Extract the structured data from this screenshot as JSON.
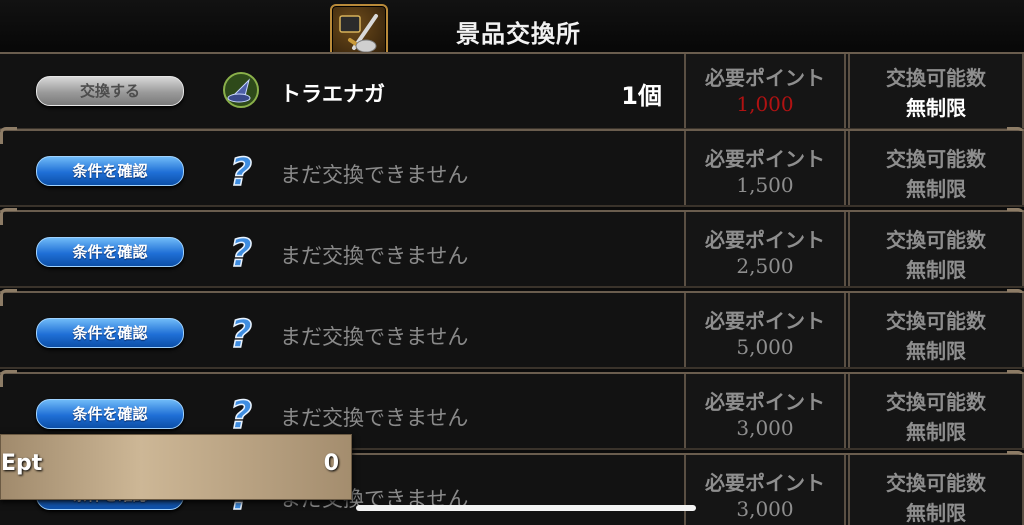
{
  "header": {
    "title": "景品交換所",
    "logo_icon": "sword-shield-icon"
  },
  "columns": {
    "points_label": "必要ポイント",
    "limit_label": "交換可能数"
  },
  "rows": [
    {
      "button": "交換する",
      "button_style": "gray",
      "icon": "wizard-hat-icon",
      "name": "トラエナガ",
      "quantity": "1個",
      "points": "1,000",
      "points_color": "#b01212",
      "limit": "無制限"
    },
    {
      "button": "条件を確認",
      "button_style": "blue",
      "icon": "question-mark-icon",
      "name": "まだ交換できません",
      "points": "1,500",
      "limit": "無制限"
    },
    {
      "button": "条件を確認",
      "button_style": "blue",
      "icon": "question-mark-icon",
      "name": "まだ交換できません",
      "points": "2,500",
      "limit": "無制限"
    },
    {
      "button": "条件を確認",
      "button_style": "blue",
      "icon": "question-mark-icon",
      "name": "まだ交換できません",
      "points": "5,000",
      "limit": "無制限"
    },
    {
      "button": "条件を確認",
      "button_style": "blue",
      "icon": "question-mark-icon",
      "name": "まだ交換できません",
      "points": "3,000",
      "limit": "無制限"
    },
    {
      "button": "条件を確認",
      "button_style": "blue",
      "icon": "question-mark-icon",
      "name": "まだ交換できません",
      "points": "3,000",
      "limit": "無制限"
    }
  ],
  "ept": {
    "label": "Ept",
    "value": "0"
  }
}
